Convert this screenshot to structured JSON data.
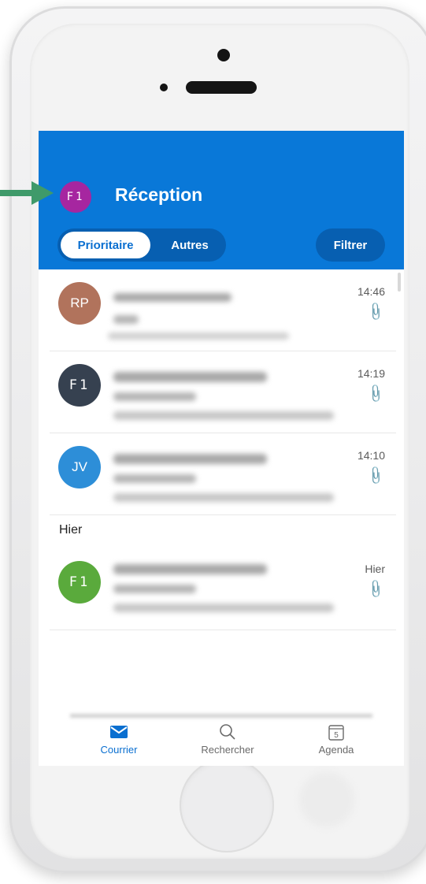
{
  "header": {
    "account_initials": "F1",
    "title": "Réception",
    "tabs": [
      {
        "label": "Prioritaire",
        "selected": true
      },
      {
        "label": "Autres",
        "selected": false
      }
    ],
    "filter_label": "Filtrer"
  },
  "messages": [
    {
      "avatar": "RP",
      "avatar_color": "#b1735c",
      "time": "14:46",
      "has_attachment": true
    },
    {
      "avatar": "F1",
      "avatar_color": "#364150",
      "avatar_logo": true,
      "time": "14:19",
      "has_attachment": true
    },
    {
      "avatar": "JV",
      "avatar_color": "#2d8ed8",
      "time": "14:10",
      "has_attachment": true
    }
  ],
  "section_yesterday": "Hier",
  "yesterday_messages": [
    {
      "avatar": "F1",
      "avatar_color": "#5aaa3c",
      "avatar_logo": true,
      "time": "Hier",
      "has_attachment": true
    }
  ],
  "bottom_nav": [
    {
      "label": "Courrier",
      "icon": "mail-icon",
      "active": true
    },
    {
      "label": "Rechercher",
      "icon": "search-icon",
      "active": false
    },
    {
      "label": "Agenda",
      "icon": "calendar-icon",
      "calendar_day": "5",
      "active": false
    }
  ],
  "colors": {
    "brand": "#0978d8",
    "pointer_arrow": "#3f9a6a"
  }
}
